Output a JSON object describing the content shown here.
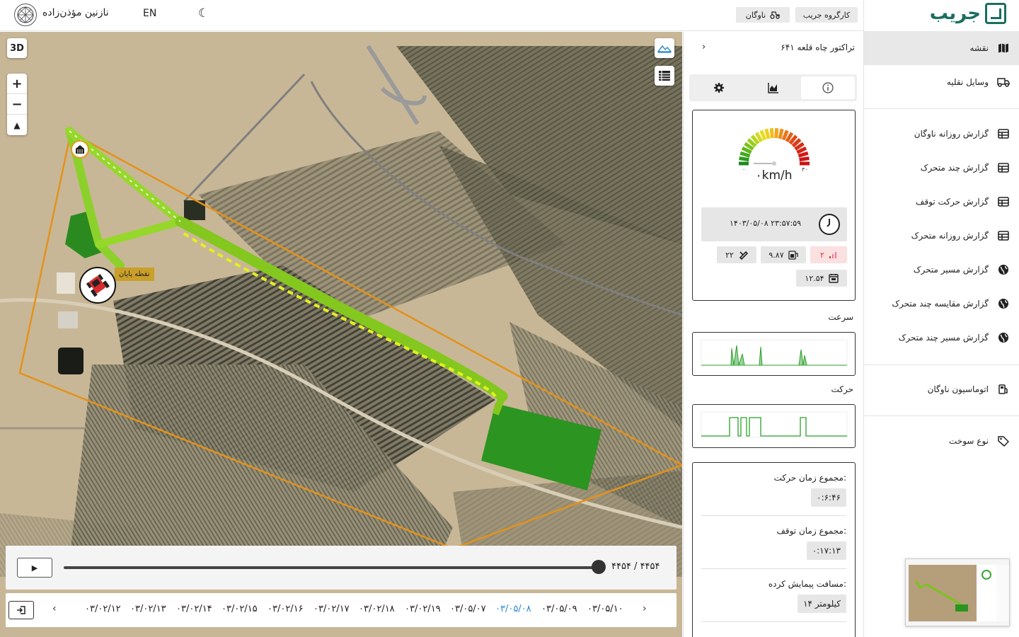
{
  "topbar": {
    "username": "نازنین مؤذن‌زاده",
    "language": "EN",
    "theme_icon": "moon-icon",
    "fleet_label": "ناوگان",
    "workgroup_label": "کارگروه جریب"
  },
  "sidebar": {
    "brand": "جریب",
    "items": [
      {
        "label": "نقشه",
        "icon": "map-icon"
      },
      {
        "label": "وسایل نقلیه",
        "icon": "truck-icon"
      },
      {
        "label": "گزارش روزانه ناوگان",
        "icon": "table-icon"
      },
      {
        "label": "گزارش چند متحرک",
        "icon": "table-icon"
      },
      {
        "label": "گزارش حرکت توقف",
        "icon": "table-icon"
      },
      {
        "label": "گزارش روزانه متحرک",
        "icon": "table-icon"
      },
      {
        "label": "گزارش مسیر متحرک",
        "icon": "globe-icon"
      },
      {
        "label": "گزارش مقایسه چند متحرک",
        "icon": "globe-icon"
      },
      {
        "label": "گزارش مسیر چند متحرک",
        "icon": "globe-icon"
      },
      {
        "label": "اتوماسیون ناوگان",
        "icon": "fuel-pump-icon"
      },
      {
        "label": "نوع سوخت",
        "icon": "tag-icon"
      }
    ]
  },
  "map": {
    "btn_3d": "3D",
    "zoom_in": "+",
    "zoom_out": "−",
    "end_point_label": "نقطه پایان"
  },
  "playback": {
    "counter": "۴۴۵۴ / ۴۴۵۴",
    "progress": 1.0
  },
  "dates": [
    "۰۳/۰۲/۱۲",
    "۰۳/۰۲/۱۳",
    "۰۳/۰۲/۱۴",
    "۰۳/۰۲/۱۵",
    "۰۳/۰۲/۱۶",
    "۰۳/۰۲/۱۷",
    "۰۳/۰۲/۱۸",
    "۰۳/۰۲/۱۹",
    "۰۳/۰۵/۰۷",
    "۰۳/۰۵/۰۸",
    "۰۳/۰۵/۰۹",
    "۰۳/۰۵/۱۰"
  ],
  "active_date": "۰۳/۰۵/۰۸",
  "panel": {
    "title": "تراکتور چاه قلعه ۶۴۱",
    "gauge": {
      "min": "۰",
      "max": "۳۰",
      "value": 0,
      "unit": "km/h",
      "speed_text": "۰km/h"
    },
    "datetime": "۱۴۰۳/۰۵/۰۸ ۲۳:۵۷:۵۹",
    "chips": {
      "signal": "۲",
      "battery": "۹.۸۷",
      "satellites": "۲۲",
      "odometer": "۱۲.۵۴"
    },
    "speed_label": "سرعت",
    "motion_label": "حرکت",
    "stats": [
      {
        "label": "مجموع زمان حرکت:",
        "value": "۰:۶:۴۶"
      },
      {
        "label": "مجموع زمان توقف:",
        "value": "۰:۱۷:۱۳"
      },
      {
        "label": "مسافت پیمایش کرده:",
        "value": "۱۴ کیلومتر"
      }
    ]
  },
  "colors": {
    "brand": "#1a6e60",
    "route": "#7cc21e",
    "boundary": "#e3921b",
    "active_date": "#2b8ad9"
  }
}
